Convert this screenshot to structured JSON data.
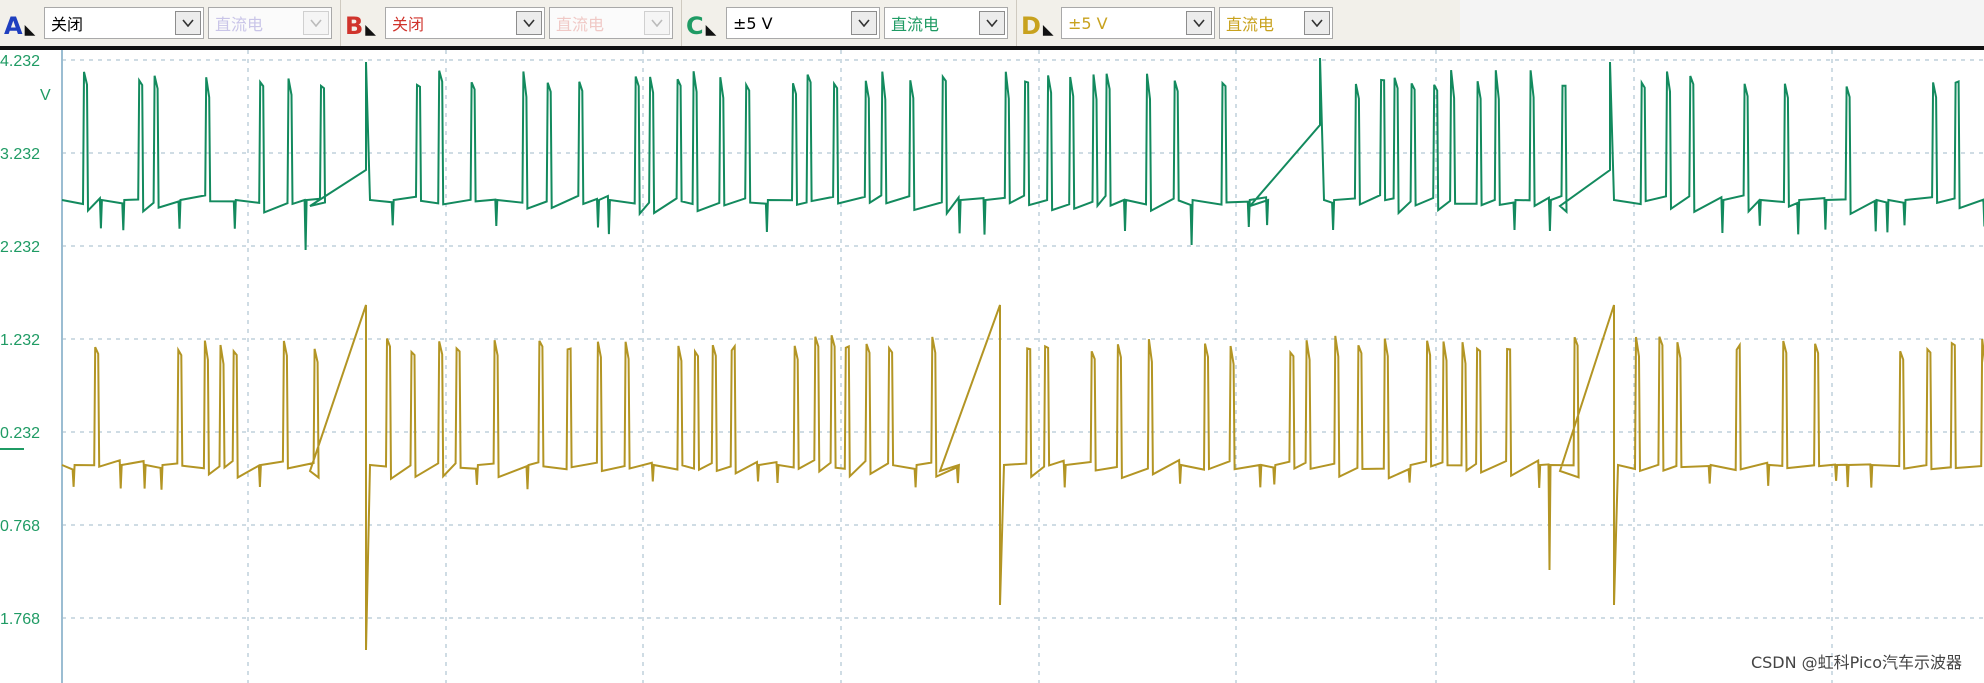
{
  "toolbar": {
    "channels": [
      {
        "letter": "A",
        "color": "#1f3fbf",
        "range": "关闭",
        "coupling": "直流电",
        "coupling_disabled": true
      },
      {
        "letter": "B",
        "color": "#d0342c",
        "range": "关闭",
        "coupling": "直流电",
        "coupling_disabled": true
      },
      {
        "letter": "C",
        "color": "#1f9b64",
        "range": "±5 V",
        "coupling": "直流电",
        "coupling_disabled": false
      },
      {
        "letter": "D",
        "color": "#c8a21e",
        "range": "±5 V",
        "coupling": "直流电",
        "coupling_disabled": false
      }
    ]
  },
  "plot": {
    "y_ticks": [
      "4.232",
      "3.232",
      "2.232",
      "1.232",
      "0.232",
      "0.768",
      "1.768"
    ],
    "unit": "V",
    "channel_c_color": "#138a5e",
    "channel_d_color": "#b39524",
    "grid_color": "#9fb9c9"
  },
  "watermark": "CSDN @虹科Pico汽车示波器"
}
